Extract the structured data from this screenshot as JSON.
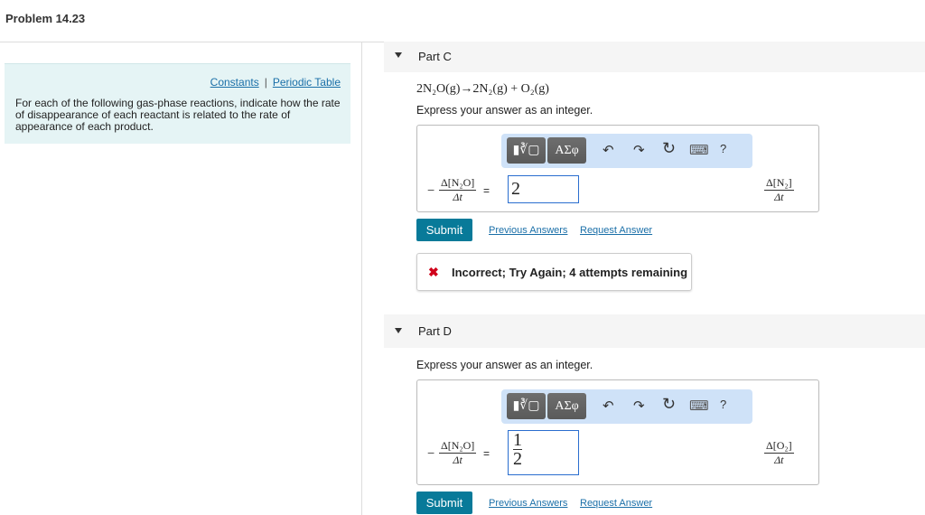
{
  "title": "Problem 14.23",
  "info": {
    "constants": "Constants",
    "separator": "|",
    "periodic_table": "Periodic Table",
    "intro": "For each of the following gas-phase reactions, indicate how the rate of disappearance of each reactant is related to the rate of appearance of each product."
  },
  "toolbar": {
    "templates": "▮∛▢",
    "greek": "ΑΣφ",
    "undo": "↶",
    "redo": "↷",
    "reset": "↻",
    "keyboard": "⌨",
    "help": "?"
  },
  "partC": {
    "label": "Part C",
    "equation": "2N₂O(g)→2N₂(g) + O₂(g)",
    "instruction": "Express your answer as an integer.",
    "left_num": "Δ[N₂O]",
    "left_den": "Δt",
    "minus": "−",
    "equals": "=",
    "answer": "2",
    "right_num": "Δ[N₂]",
    "right_den": "Δt",
    "submit": "Submit",
    "previous": "Previous Answers",
    "request": "Request Answer",
    "feedback": "Incorrect; Try Again; 4 attempts remaining",
    "feedback_icon": "✖"
  },
  "partD": {
    "label": "Part D",
    "instruction": "Express your answer as an integer.",
    "left_num": "Δ[N₂O]",
    "left_den": "Δt",
    "minus": "−",
    "equals": "=",
    "answer_num": "1",
    "answer_den": "2",
    "right_num": "Δ[O₂]",
    "right_den": "Δt",
    "submit": "Submit",
    "previous": "Previous Answers",
    "request": "Request Answer"
  }
}
